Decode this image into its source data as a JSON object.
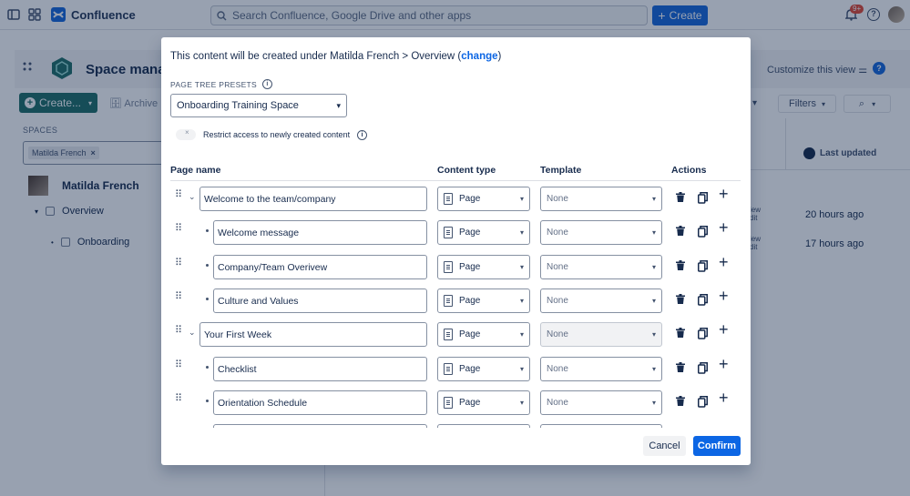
{
  "topbar": {
    "app_name": "Confluence",
    "search_placeholder": "Search Confluence, Google Drive and other apps",
    "create_label": "Create",
    "notification_count": "9+"
  },
  "space": {
    "title": "Space manag",
    "customize_label": "Customize this view",
    "create_label": "Create...",
    "archive_label": "Archive",
    "filters_label": "Filters",
    "spaces_label": "SPACES",
    "filter_chip": "Matilda French",
    "user_name": "Matilda French",
    "tree": [
      "Overview",
      "Onboarding"
    ],
    "last_updated_label": "Last updated",
    "rows": [
      {
        "view": "iew",
        "edit": "dit",
        "time": "20 hours ago"
      },
      {
        "view": "iew",
        "edit": "dit",
        "time": "17 hours ago"
      }
    ]
  },
  "modal": {
    "info_prefix": "This content will be created under Matilda French > Overview (",
    "change_link": "change",
    "info_suffix": ")",
    "presets_label": "PAGE TREE PRESETS",
    "preset_value": "Onboarding Training Space",
    "restrict_label": "Restrict access to newly created content",
    "columns": {
      "page_name": "Page name",
      "content_type": "Content type",
      "template": "Template",
      "actions": "Actions"
    },
    "rows": [
      {
        "name": "Welcome to the team/company",
        "type": "Page",
        "template": "None",
        "level": 0
      },
      {
        "name": "Welcome message",
        "type": "Page",
        "template": "None",
        "level": 1
      },
      {
        "name": "Company/Team Overivew",
        "type": "Page",
        "template": "None",
        "level": 1
      },
      {
        "name": "Culture and Values",
        "type": "Page",
        "template": "None",
        "level": 1
      },
      {
        "name": "Your First Week",
        "type": "Page",
        "template": "None",
        "level": 0
      },
      {
        "name": "Checklist",
        "type": "Page",
        "template": "None",
        "level": 1
      },
      {
        "name": "Orientation Schedule",
        "type": "Page",
        "template": "None",
        "level": 1
      }
    ],
    "cancel_label": "Cancel",
    "confirm_label": "Confirm"
  },
  "colors": {
    "primary": "#0c66e4",
    "create_button": "#1868db",
    "space_create": "#1f6f68",
    "overlay": "rgba(9,30,66,0.42)"
  }
}
